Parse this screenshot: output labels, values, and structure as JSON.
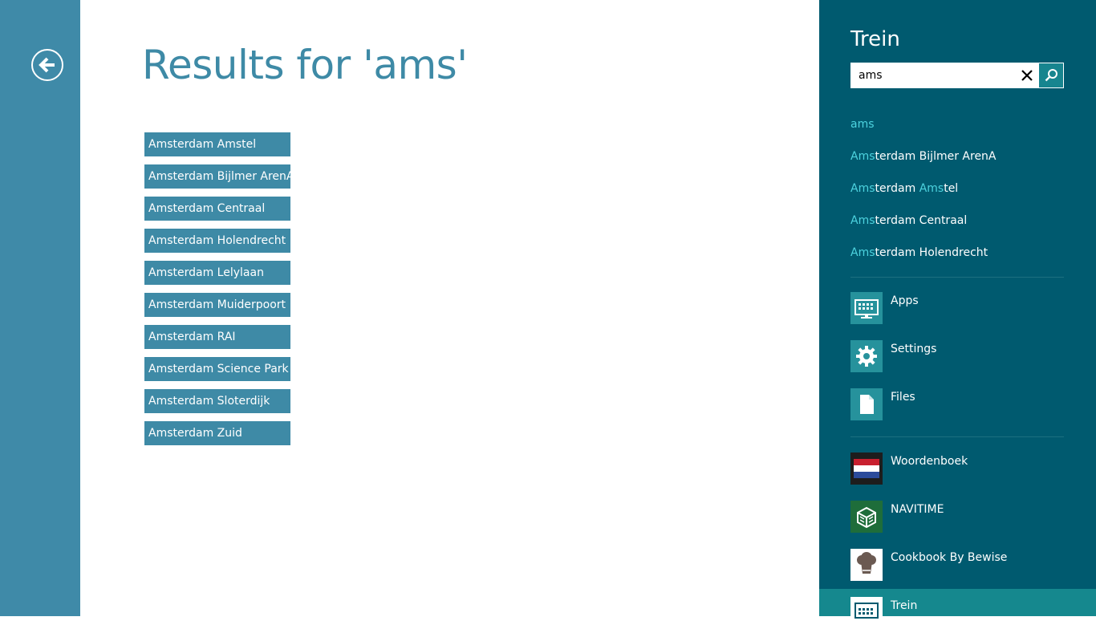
{
  "main": {
    "title": "Results for 'ams'",
    "results": [
      "Amsterdam Amstel",
      "Amsterdam Bijlmer ArenA",
      "Amsterdam Centraal",
      "Amsterdam Holendrecht",
      "Amsterdam Lelylaan",
      "Amsterdam Muiderpoort",
      "Amsterdam RAI",
      "Amsterdam Science Park",
      "Amsterdam Sloterdijk",
      "Amsterdam Zuid"
    ]
  },
  "search_pane": {
    "title": "Trein",
    "query": "ams",
    "suggestions": [
      {
        "hl": "ams",
        "rest": ""
      },
      {
        "hl": "Ams",
        "rest": "terdam Bijlmer ArenA"
      },
      {
        "hl": "Ams",
        "rest": "terdam ",
        "hl2": "Ams",
        "rest2": "tel"
      },
      {
        "hl": "Ams",
        "rest": "terdam Centraal"
      },
      {
        "hl": "Ams",
        "rest": "terdam Holendrecht"
      }
    ],
    "scopes": {
      "apps": "Apps",
      "settings": "Settings",
      "files": "Files"
    },
    "apps": {
      "woordenboek": "Woordenboek",
      "navitime": "NAVITIME",
      "cookbook": "Cookbook By Bewise",
      "trein": "Trein"
    }
  },
  "colors": {
    "accent": "#3e8aa6",
    "pane_bg": "#005a6f",
    "highlight": "#4dd3df",
    "scope_tile": "#26929c",
    "selected_row": "#15888e"
  },
  "icons": {
    "back": "back-arrow-icon",
    "clear": "close-icon",
    "search": "search-icon",
    "apps": "apps-icon",
    "settings": "gear-icon",
    "files": "file-icon"
  }
}
